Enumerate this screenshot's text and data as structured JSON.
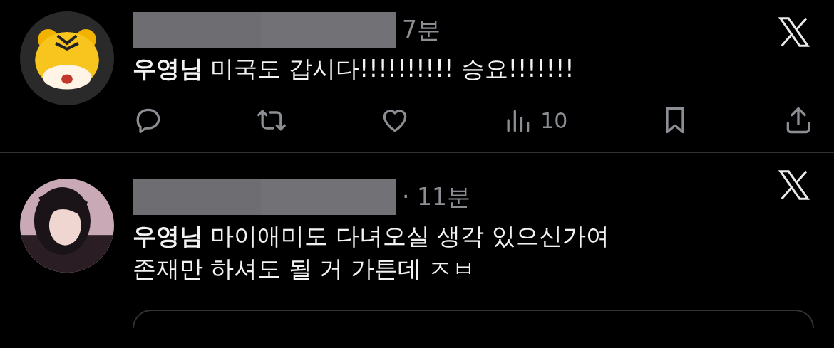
{
  "tweets": [
    {
      "author_redacted": true,
      "time": "7분",
      "text_lines": [
        "**우영님** 미국도 갑시다!!!!!!!!!! 승요!!!!!!!"
      ],
      "actions": [
        {
          "kind": "reply"
        },
        {
          "kind": "repost"
        },
        {
          "kind": "like"
        },
        {
          "kind": "views",
          "count": "10"
        },
        {
          "kind": "bookmark"
        },
        {
          "kind": "share"
        }
      ],
      "has_quote_card": false
    },
    {
      "author_redacted": true,
      "time": "· 11분",
      "text_lines": [
        "**우영님** 마이애미도 다녀오실 생각 있으신가여",
        "존재만 하셔도 될 거 가튼데 ㅈㅂ"
      ],
      "has_quote_card": true
    }
  ]
}
